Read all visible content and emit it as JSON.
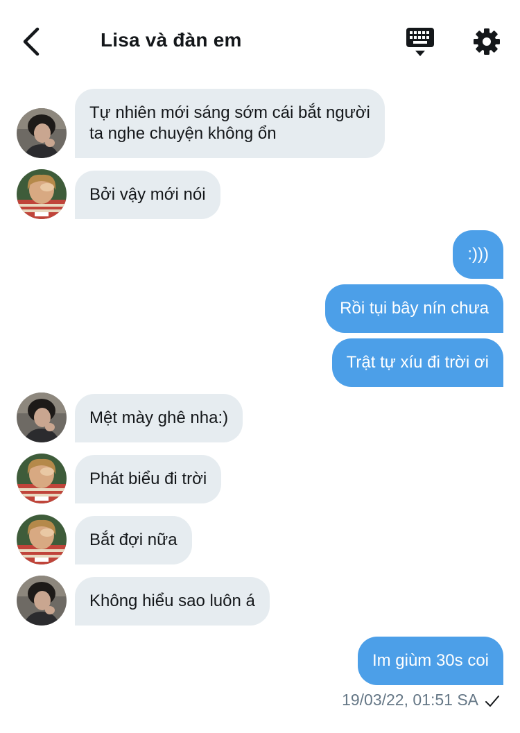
{
  "header": {
    "title": "Lisa và đàn em",
    "back_icon": "chevron-left-icon",
    "keyboard_icon": "keyboard-icon",
    "settings_icon": "gear-icon"
  },
  "messages": [
    {
      "dir": "in",
      "avatar": "boy",
      "lines": [
        "Tự nhiên mới sáng sớm cái bắt người",
        "ta nghe chuyện không ổn"
      ]
    },
    {
      "dir": "in",
      "avatar": "girl",
      "lines": [
        "Bởi vậy mới nói"
      ]
    },
    {
      "dir": "out",
      "lines": [
        ":)))"
      ]
    },
    {
      "dir": "out",
      "lines": [
        "Rồi tụi bây nín chưa"
      ]
    },
    {
      "dir": "out",
      "lines": [
        "Trật tự xíu đi trời ơi"
      ]
    },
    {
      "dir": "in",
      "avatar": "boy",
      "lines": [
        "Mệt mày ghê nha:)"
      ]
    },
    {
      "dir": "in",
      "avatar": "girl",
      "lines": [
        "Phát biểu đi trời"
      ]
    },
    {
      "dir": "in",
      "avatar": "girl",
      "lines": [
        "Bắt đợi nữa"
      ]
    },
    {
      "dir": "in",
      "avatar": "boy",
      "lines": [
        "Không hiểu sao luôn á"
      ]
    },
    {
      "dir": "out",
      "lines": [
        "Im giùm 30s coi"
      ]
    }
  ],
  "status": {
    "timestamp": "19/03/22, 01:51 SA",
    "check_icon": "check-icon"
  },
  "colors": {
    "incoming_bubble": "#e6ecf0",
    "outgoing_bubble": "#4c9fe8",
    "text": "#14171a",
    "meta_text": "#657786"
  }
}
